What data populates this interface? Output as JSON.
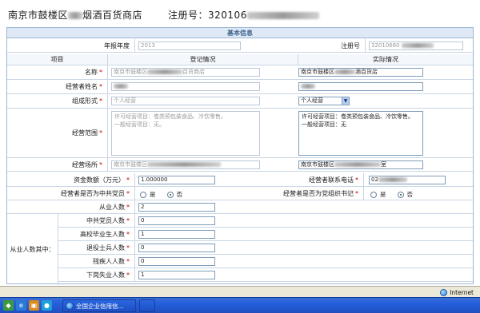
{
  "header": {
    "company_name_prefix": "南京市鼓楼区",
    "company_name_suffix": "烟酒百货商店",
    "reg_label": "注册号：",
    "reg_value_prefix": "320106"
  },
  "form": {
    "section_title": "基本信息",
    "year_label": "年报年度",
    "year_value": "2013",
    "reg_no_label": "注册号",
    "reg_no_value": "32010660",
    "col_item": "项目",
    "col_registered": "登记情况",
    "col_actual": "实际情况",
    "name_label": "名称",
    "name_registered_prefix": "南京市鼓楼区",
    "name_registered_suffix": "百货商店",
    "name_actual_prefix": "南京市鼓楼区",
    "name_actual_suffix": "酒百货店",
    "operator_label": "经营者姓名",
    "form_label": "组成形式",
    "form_registered": "个人经营",
    "form_actual": "个人经营",
    "scope_label": "经营范围",
    "scope_registered": "许可经营项目：卷类预包装食品、冷饮零售。\n一般经营项目：无。",
    "scope_actual": "许可经营项目：卷类预包装食品、冷饮零售。\n一般经营项目：无",
    "place_label": "经营场所",
    "place_registered_prefix": "南京市鼓楼区",
    "place_actual_prefix": "南京市鼓楼区",
    "place_actual_suffix": "室",
    "capital_label": "资金数额（万元）",
    "capital_value": "1.000000",
    "phone_label": "经营者联系电话",
    "phone_prefix": "02",
    "party_label": "经营者是否为中共党员",
    "secretary_label": "经营者是否为党组织书记",
    "yes_label": "是",
    "no_label": "否",
    "staff_label": "从业人数",
    "staff_value": "2",
    "staff_among_label": "从业人数其中：",
    "party_count_label": "中共党员人数",
    "party_count_value": "0",
    "college_label": "高校毕业生人数",
    "college_value": "1",
    "veteran_label": "退役士兵人数",
    "veteran_value": "0",
    "disabled_label": "残疾人人数",
    "disabled_value": "0",
    "laidoff_label": "下岗失业人数",
    "laidoff_value": "1"
  },
  "status": {
    "zone": "Internet"
  },
  "taskbar": {
    "window_title": "全国企业信用信..."
  }
}
